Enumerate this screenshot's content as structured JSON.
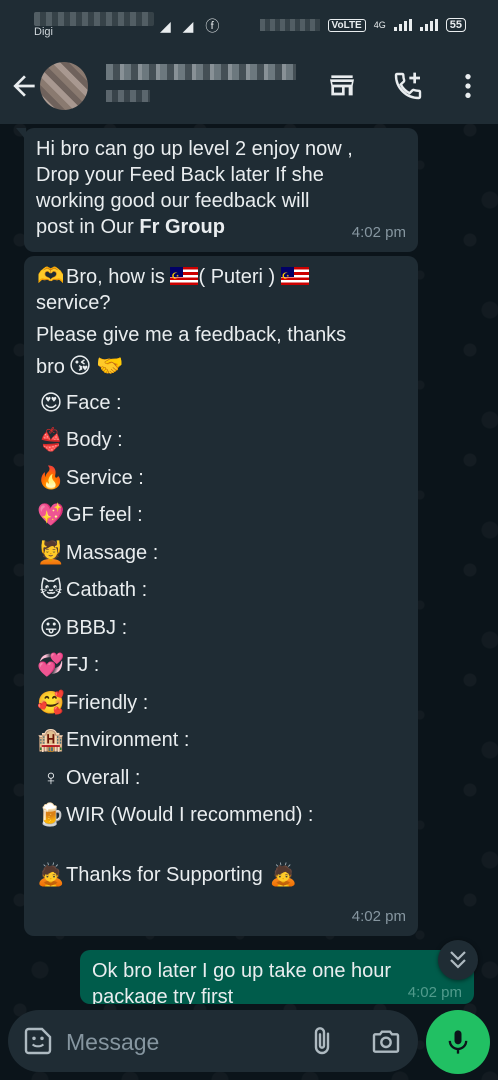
{
  "status_bar": {
    "carrier": "Digi",
    "notification_icons": "◢ ◢ ⓕ",
    "volte": "VoLTE",
    "network": "4G",
    "battery": "55"
  },
  "header": {
    "contact_name": "",
    "contact_status": ""
  },
  "messages": [
    {
      "direction": "incoming",
      "lines": [
        "Hi bro can go up level 2 enjoy now ,",
        "Drop your Feed Back later If she",
        "working good our feedback will",
        "post in Our "
      ],
      "bold_suffix": "Fr Group",
      "time": "4:02 pm"
    },
    {
      "direction": "incoming",
      "intro": {
        "line1_pre": "Bro, how is ",
        "line1_mid": "( Puteri )",
        "line2": "service?",
        "line3": "Please give me a feedback, thanks",
        "line4": "bro"
      },
      "items": [
        {
          "icon": "😍",
          "icon_name": "heart-eyes-icon",
          "label": "Face :"
        },
        {
          "icon": "👙",
          "icon_name": "bikini-icon",
          "label": "Body :"
        },
        {
          "icon": "🔥",
          "icon_name": "fire-icon",
          "label": "Service :"
        },
        {
          "icon": "💖",
          "icon_name": "sparkling-heart-icon",
          "label": "GF feel :"
        },
        {
          "icon": "💆",
          "icon_name": "massage-icon",
          "label": "Massage :"
        },
        {
          "icon": "🐱",
          "icon_name": "cat-icon",
          "label": "Catbath :"
        },
        {
          "icon": "😛",
          "icon_name": "tongue-icon",
          "label": "BBBJ :"
        },
        {
          "icon": "💞",
          "icon_name": "hearts-icon",
          "label": "FJ :"
        },
        {
          "icon": "🥰",
          "icon_name": "smiling-hearts-icon",
          "label": "Friendly :"
        },
        {
          "icon": "🏨",
          "icon_name": "hotel-icon",
          "label": "Environment :"
        },
        {
          "icon": "♀",
          "icon_name": "female-sign-icon",
          "label": "Overall :"
        },
        {
          "icon": "🍺",
          "icon_name": "beer-icon",
          "label": "WIR (Would I recommend) :"
        }
      ],
      "thanks": "Thanks for Supporting",
      "time": "4:02 pm"
    },
    {
      "direction": "outgoing",
      "lines": [
        "Ok bro later I go up take one hour",
        "package try first"
      ],
      "time": "4:02 pm"
    }
  ],
  "composer": {
    "placeholder": "Message"
  },
  "colors": {
    "header_bg": "#1f2c34",
    "incoming_bubble": "#1f2c34",
    "outgoing_bubble": "#005c4b",
    "mic_button": "#21c063",
    "background": "#0b141a"
  }
}
